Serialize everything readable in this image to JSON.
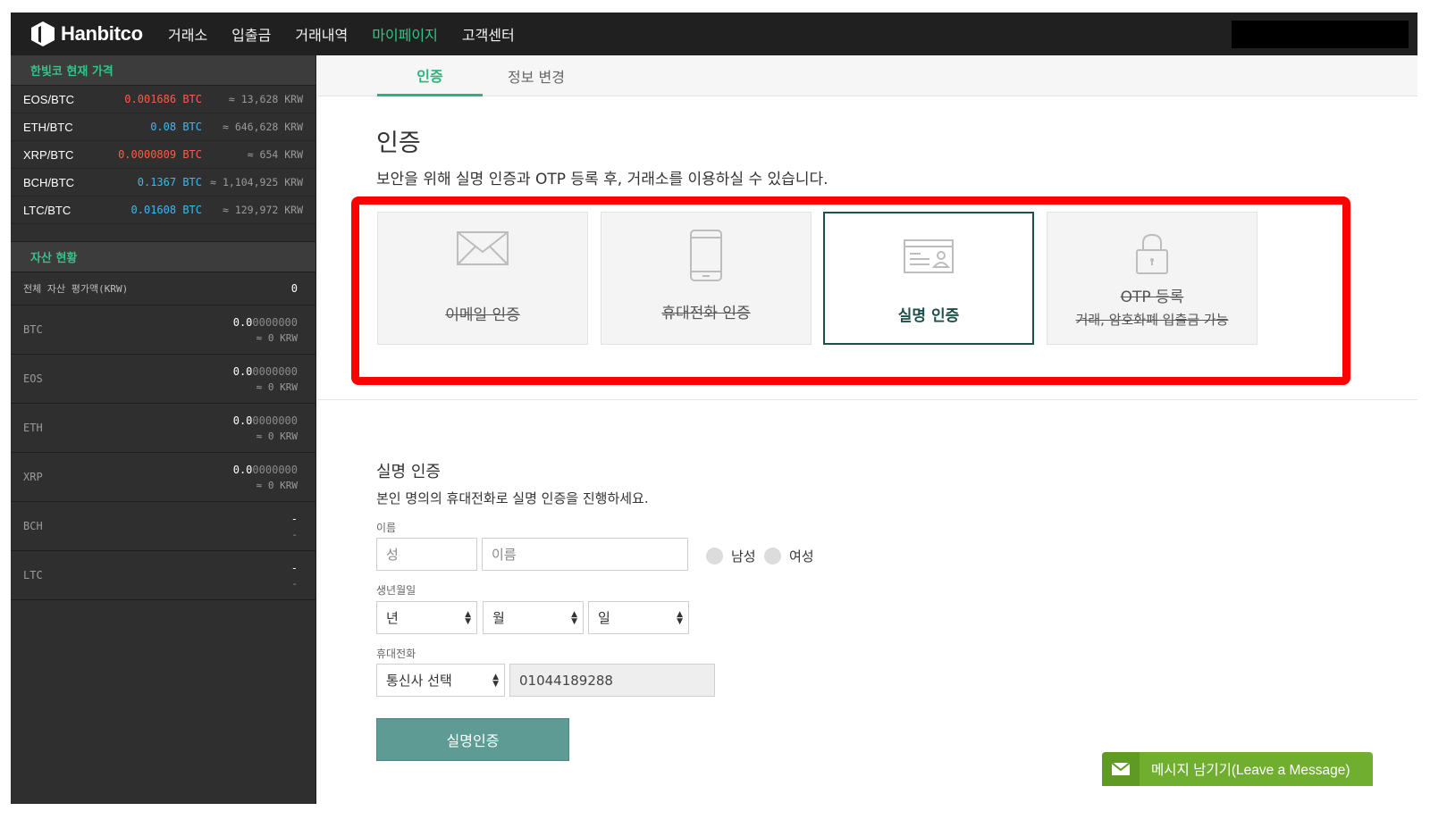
{
  "brand": {
    "name": "Hanbitco"
  },
  "nav": {
    "items": [
      "거래소",
      "입출금",
      "거래내역",
      "마이페이지",
      "고객센터"
    ],
    "active_index": 3
  },
  "sidebar": {
    "price_title": "한빛코 현재 가격",
    "prices": [
      {
        "pair": "EOS/BTC",
        "value": "0.001686 BTC",
        "krw": "≈ 13,628 KRW",
        "color": "red"
      },
      {
        "pair": "ETH/BTC",
        "value": "0.08 BTC",
        "krw": "≈ 646,628 KRW",
        "color": "blue"
      },
      {
        "pair": "XRP/BTC",
        "value": "0.0000809 BTC",
        "krw": "≈ 654 KRW",
        "color": "red"
      },
      {
        "pair": "BCH/BTC",
        "value": "0.1367 BTC",
        "krw": "≈ 1,104,925 KRW",
        "color": "blue"
      },
      {
        "pair": "LTC/BTC",
        "value": "0.01608 BTC",
        "krw": "≈ 129,972 KRW",
        "color": "blue"
      }
    ],
    "asset_title": "자산 현황",
    "asset_total_label": "전체 자산 평가액(KRW)",
    "asset_total_value": "0",
    "assets": [
      {
        "coin": "BTC",
        "amount_lead": "0.0",
        "amount_tail": "0000000",
        "krw": "≈ 0 KRW"
      },
      {
        "coin": "EOS",
        "amount_lead": "0.0",
        "amount_tail": "0000000",
        "krw": "≈ 0 KRW"
      },
      {
        "coin": "ETH",
        "amount_lead": "0.0",
        "amount_tail": "0000000",
        "krw": "≈ 0 KRW"
      },
      {
        "coin": "XRP",
        "amount_lead": "0.0",
        "amount_tail": "0000000",
        "krw": "≈ 0 KRW"
      },
      {
        "coin": "BCH",
        "amount_lead": "-",
        "amount_tail": "",
        "krw": "-"
      },
      {
        "coin": "LTC",
        "amount_lead": "-",
        "amount_tail": "",
        "krw": "-"
      }
    ]
  },
  "tabs": {
    "auth": "인증",
    "info_change": "정보 변경"
  },
  "section": {
    "title": "인증",
    "description": "보안을 위해 실명 인증과 OTP 등록 후, 거래소를 이용하실 수 있습니다."
  },
  "cards": [
    {
      "label": "이메일 인증",
      "icon": "envelope-icon",
      "state": "completed"
    },
    {
      "label": "휴대전화 인증",
      "icon": "smartphone-icon",
      "state": "completed"
    },
    {
      "label": "실명 인증",
      "icon": "id-card-icon",
      "state": "active"
    },
    {
      "label": "OTP 등록",
      "sub": "거래, 암호화폐 입출금 가능",
      "icon": "lock-icon",
      "state": "completed"
    }
  ],
  "form": {
    "title": "실명 인증",
    "description": "본인 명의의 휴대전화로 실명 인증을 진행하세요.",
    "name_label": "이름",
    "last_name_placeholder": "성",
    "first_name_placeholder": "이름",
    "gender_male": "남성",
    "gender_female": "여성",
    "birth_label": "생년월일",
    "year": "년",
    "month": "월",
    "day": "일",
    "phone_label": "휴대전화",
    "carrier": "통신사 선택",
    "phone_value": "01044189288",
    "submit": "실명인증"
  },
  "chat": {
    "label": "메시지 남기기(Leave a Message)"
  },
  "colors": {
    "accent": "#2bb57d",
    "highlight_border": "#ff0000",
    "button": "#5d9b94",
    "chat": "#6fae2f"
  }
}
